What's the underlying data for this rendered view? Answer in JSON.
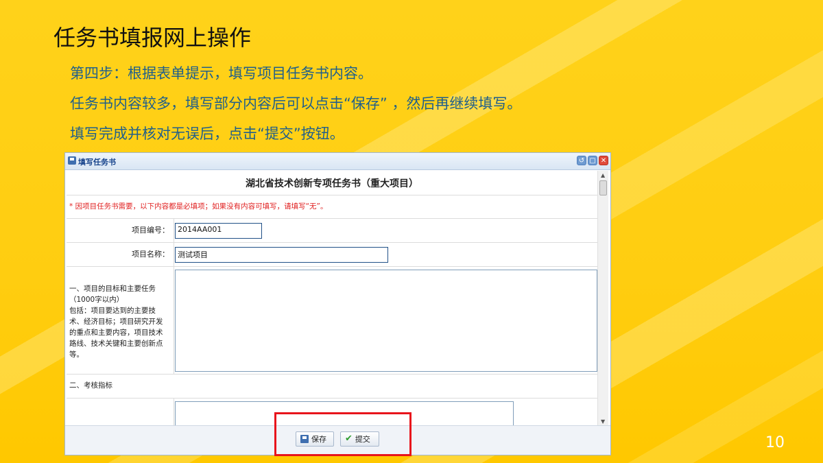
{
  "slide": {
    "title": "任务书填报网上操作",
    "bullets": [
      "第四步：根据表单提示，填写项目任务书内容。",
      "任务书内容较多，填写部分内容后可以点击“保存”  ，然后再继续填写。",
      "填写完成并核对无误后，点击“提交”按钮。"
    ],
    "page_number": "10"
  },
  "window": {
    "title": "填写任务书",
    "form_title": "湖北省技术创新专项任务书（重大项目）",
    "notice": "* 因项目任务书需要，以下内容都是必填项；如果没有内容可填写，请填写“无”。",
    "project_no_label": "项目编号：",
    "project_no_value": "2014AA001",
    "project_name_label": "项目名称：",
    "project_name_value": "测试项目",
    "goal_label_lines": [
      "一、项目的目标和主要任务",
      "（1000字以内）",
      "包括：项目要达到的主要技",
      "术、经济目标；项目研究开发",
      "的重点和主要内容，项目技术",
      "路线、技术关键和主要创新点",
      "等。"
    ],
    "section2_label": "二、考核指标",
    "save_label": "保存",
    "submit_label": "提交"
  },
  "colors": {
    "background": "#ffd21a",
    "bullet_text": "#1f5f8b",
    "highlight_box": "#e8141c",
    "notice_text": "#e02020"
  }
}
